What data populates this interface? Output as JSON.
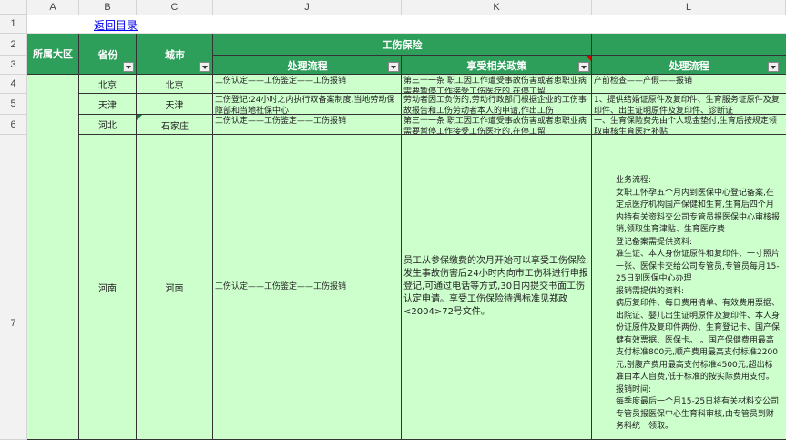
{
  "columns": [
    "A",
    "B",
    "C",
    "J",
    "K",
    "L"
  ],
  "rows": [
    "1",
    "2",
    "3",
    "4",
    "5",
    "6",
    "7"
  ],
  "link": "返回目录",
  "headers": {
    "region": "所属大区",
    "province": "省份",
    "city": "城市",
    "group": "工伤保险",
    "process": "处理流程",
    "policy": "享受相关政策",
    "process2": "处理流程"
  },
  "data_rows": [
    {
      "province": "北京",
      "city": "北京",
      "process": "工伤认定——工伤鉴定——工伤报销",
      "policy": "第三十一条 职工因工作遭受事故伤害或者患职业病需要暂停工作接受工伤医疗的,在停工留",
      "process2": "产前检查——产假——报销"
    },
    {
      "province": "天津",
      "city": "天津",
      "process": "工伤登记:24小时之内执行双备案制度,当地劳动保障部和当地社保中心",
      "policy": "劳动者因工负伤的,劳动行政部门根据企业的工伤事故报告和工伤劳动者本人的申请,作出工伤",
      "process2": "1、提供结婚证原件及复印件、生育服务证原件及复印件、出生证明原件及复印件、诊断证"
    },
    {
      "province": "河北",
      "city": "石家庄",
      "process": "工伤认定——工伤鉴定——工伤报销",
      "policy": "第三十一条 职工因工作遭受事故伤害或者患职业病需要暂停工作接受工伤医疗的,在停工留",
      "process2": "一、生育保险费先由个人现金垫付,生育后按规定领取审核生育医疗补贴"
    },
    {
      "province": "河南",
      "city": "河南",
      "process": "工伤认定——工伤鉴定——工伤报销",
      "policy": "员工从参保缴费的次月开始可以享受工伤保险,发生事故伤害后24小时内向市工伤科进行申报登记,可通过电话等方式,30日内提交书面工伤认定申请。享受工伤保险待遇标准见郑政<2004>72号文件。",
      "process2": "业务流程:\n女职工怀孕五个月内到医保中心登记备案,在定点医疗机构国产保健和生育,生育后四个月内持有关资料交公司专管员报医保中心审核报销,领取生育津贴、生育医疗费\n登记备案需提供资料:\n准生证、本人身份证原件和复印件、一寸照片一张、医保卡交给公司专管员,专管员每月15-25日到医保中心办理\n报销需提供的资料:\n病历复印件、每日费用清单、有效费用票据、出院证、婴儿出生证明原件及复印件、本人身份证原件及复印件两份、生育登记卡、国产保健有效票据、医保卡。 。国产保健费用最高支付标准800元,顺产费用最高支付标准2200元,剖腹产费用最高支付标准4500元,超出标准由本人自费,低于标准的按实际费用支付。\n报销时间:\n每季度最后一个月15-25日将有关材料交公司专管员报医保中心生育科审核,由专管员到财务科统一领取。"
    }
  ],
  "region_value": ""
}
